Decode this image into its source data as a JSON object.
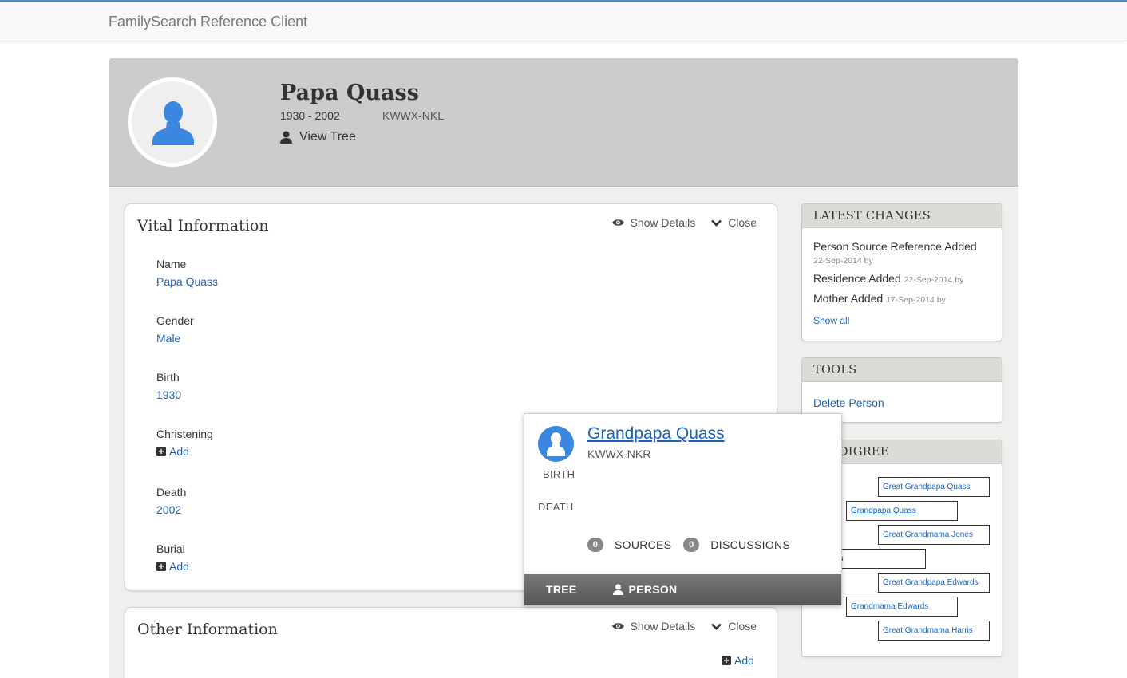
{
  "navbar": {
    "brand": "FamilySearch Reference Client"
  },
  "person": {
    "name": "Papa Quass",
    "dates": "1930 - 2002",
    "id": "KWWX-NKL",
    "view_tree_label": "View Tree"
  },
  "vital": {
    "title": "Vital Information",
    "show_details": "Show Details",
    "close": "Close",
    "fields": [
      {
        "label": "Name",
        "value": "Papa Quass"
      },
      {
        "label": "Gender",
        "value": "Male"
      },
      {
        "label": "Birth",
        "value": "1930"
      },
      {
        "label": "Christening",
        "value": "Add"
      },
      {
        "label": "Death",
        "value": "2002"
      },
      {
        "label": "Burial",
        "value": "Add"
      }
    ]
  },
  "other": {
    "title": "Other Information",
    "show_details": "Show Details",
    "close": "Close",
    "add": "Add"
  },
  "latest_changes": {
    "title": "LATEST CHANGES",
    "items": [
      {
        "label": "Person Source Reference Added",
        "meta": "22-Sep-2014 by"
      },
      {
        "label": "Residence Added",
        "meta": "22-Sep-2014 by"
      },
      {
        "label": "Mother Added",
        "meta": "17-Sep-2014 by"
      }
    ],
    "show_all": "Show all"
  },
  "tools": {
    "title": "TOOLS",
    "delete": "Delete Person"
  },
  "pedigree": {
    "title_visible": "I PEDIGREE",
    "boxes": [
      "Great Grandpapa Quass",
      "Grandpapa Quass",
      "Great Grandmama Jones",
      "Quass",
      "Great Grandpapa Edwards",
      "Grandmama Edwards",
      "Great Grandmama Harris"
    ]
  },
  "popup": {
    "name": "Grandpapa Quass",
    "id": "KWWX-NKR",
    "birth_label": "BIRTH",
    "death_label": "DEATH",
    "sources_count": "0",
    "sources_label": "SOURCES",
    "discussions_count": "0",
    "discussions_label": "DISCUSSIONS",
    "tab_tree": "TREE",
    "tab_person": "PERSON"
  },
  "colors": {
    "link": "#1a62b8",
    "avatar": "#3a87e0",
    "header_bg": "#cccccc",
    "nav_accent": "#3a8fd8"
  }
}
